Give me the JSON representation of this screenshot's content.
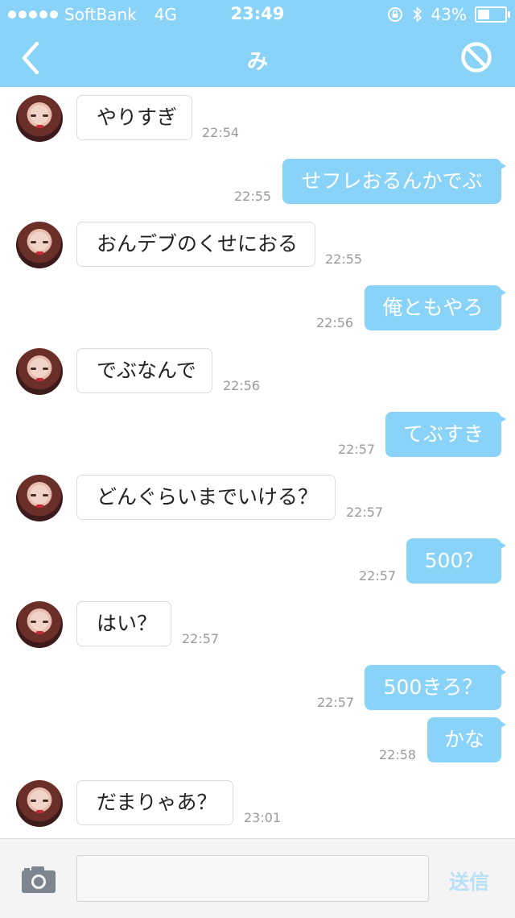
{
  "status_bar": {
    "carrier": "SoftBank",
    "network": "4G",
    "time": "23:49",
    "battery": "43%",
    "battery_level": 0.43,
    "icons": [
      "signal-dots-icon",
      "rotation-lock-icon",
      "bluetooth-icon",
      "battery-icon"
    ]
  },
  "nav": {
    "title": "み",
    "back_icon": "chevron-left-icon",
    "block_icon": "block-icon"
  },
  "messages": [
    {
      "side": "in",
      "text": "やりすぎ",
      "time": "22:54"
    },
    {
      "side": "out",
      "text": "せフレおるんかでぶ",
      "time": "22:55"
    },
    {
      "side": "in",
      "text": "おんデブのくせにおる",
      "time": "22:55"
    },
    {
      "side": "out",
      "text": "俺ともやろ",
      "time": "22:56"
    },
    {
      "side": "in",
      "text": "でぶなんで",
      "time": "22:56"
    },
    {
      "side": "out",
      "text": "てぶすき",
      "time": "22:57"
    },
    {
      "side": "in",
      "text": "どんぐらいまでいける？",
      "time": "22:57"
    },
    {
      "side": "out",
      "text": "500？",
      "time": "22:57"
    },
    {
      "side": "in",
      "text": "はい？",
      "time": "22:57"
    },
    {
      "side": "out",
      "text": "500きろ？",
      "time": "22:57"
    },
    {
      "side": "out",
      "text": "かな",
      "time": "22:58"
    },
    {
      "side": "in",
      "text": "だまりゃあ？",
      "time": "23:01"
    }
  ],
  "footer": {
    "input_value": "",
    "input_placeholder": "",
    "send_label": "送信",
    "camera_icon": "camera-icon"
  },
  "colors": {
    "accent": "#8ad3f8",
    "send_disabled": "#b9e0f5",
    "timestamp": "#9a9a9a"
  }
}
